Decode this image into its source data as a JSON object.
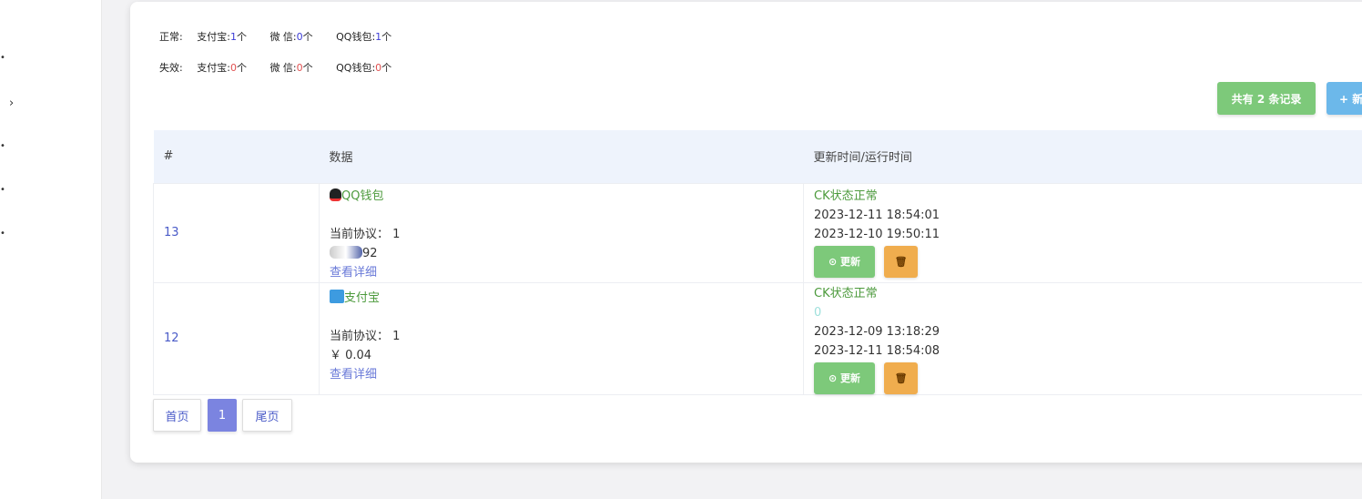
{
  "stats": {
    "normal": {
      "label": "正常:",
      "items": [
        {
          "name": "支付宝:",
          "count": "1",
          "unit": "个"
        },
        {
          "name": "微 信:",
          "count": "0",
          "unit": "个"
        },
        {
          "name": "QQ钱包:",
          "count": "1",
          "unit": "个"
        }
      ]
    },
    "invalid": {
      "label": "失效:",
      "items": [
        {
          "name": "支付宝:",
          "count": "0",
          "unit": "个"
        },
        {
          "name": "微 信:",
          "count": "0",
          "unit": "个"
        },
        {
          "name": "QQ钱包:",
          "count": "0",
          "unit": "个"
        }
      ]
    }
  },
  "toolbar": {
    "total_label": "共有 2 条记录",
    "add_label": "+ 新"
  },
  "table": {
    "headers": [
      "#",
      "数据",
      "更新时间/运行时间"
    ],
    "rows": [
      {
        "id": "13",
        "type": "QQ钱包",
        "protocol": "当前协议： 1",
        "value": "92",
        "detail": "查看详细",
        "status": "CK状态正常",
        "extra": "",
        "time1": "2023-12-11 18:54:01",
        "time2": "2023-12-10 19:50:11",
        "update": "更新"
      },
      {
        "id": "12",
        "type": "支付宝",
        "protocol": "当前协议： 1",
        "value": "￥ 0.04",
        "detail": "查看详细",
        "status": "CK状态正常",
        "extra": "0",
        "time1": "2023-12-09 13:18:29",
        "time2": "2023-12-11 18:54:08",
        "update": "更新"
      }
    ]
  },
  "pagination": {
    "first": "首页",
    "current": "1",
    "last": "尾页"
  },
  "colors": {
    "green": "#7dc97a",
    "orange": "#f0ad4e",
    "blue": "#6cb8ea",
    "page_active": "#7b84e0"
  }
}
